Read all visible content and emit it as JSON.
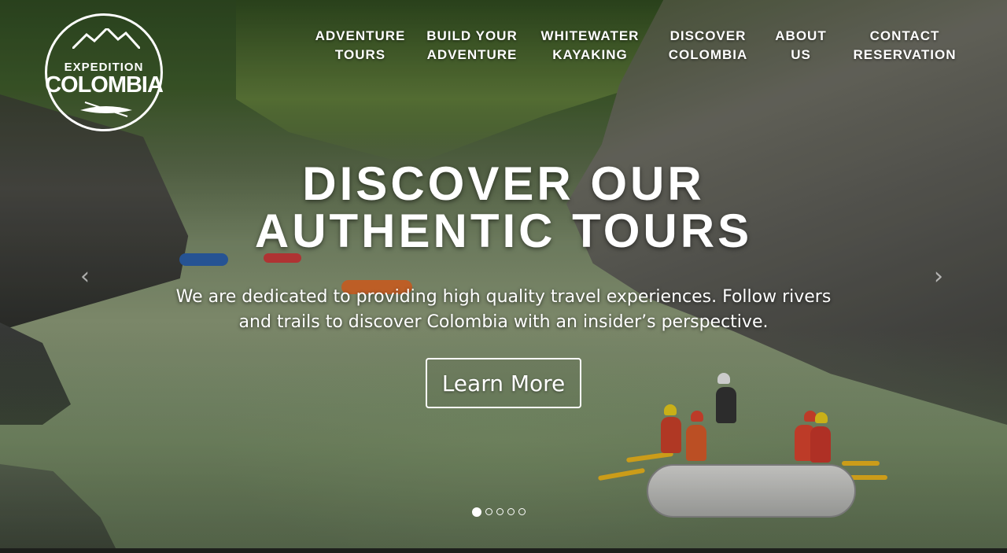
{
  "brand": {
    "logo_top": "EXPEDITION",
    "logo_main": "COLOMBIA"
  },
  "nav": {
    "items": [
      {
        "label": "ADVENTURE\nTOURS"
      },
      {
        "label": "BUILD YOUR\nADVENTURE"
      },
      {
        "label": "WHITEWATER\nKAYAKING"
      },
      {
        "label": "DISCOVER\nCOLOMBIA"
      },
      {
        "label": "ABOUT\nUS"
      },
      {
        "label": "CONTACT\nRESERVATION"
      }
    ]
  },
  "hero": {
    "headline_line1": "DISCOVER OUR",
    "headline_line2": "AUTHENTIC TOURS",
    "subtext": "We are dedicated to providing high quality travel experiences. Follow rivers and trails to discover Colombia with an insider’s perspective.",
    "cta_label": "Learn More"
  },
  "carousel": {
    "prev_icon": "chevron-left-icon",
    "next_icon": "chevron-right-icon",
    "prev_glyph": "‹",
    "next_glyph": "›",
    "active_slide": 1,
    "slide_count": 5
  }
}
